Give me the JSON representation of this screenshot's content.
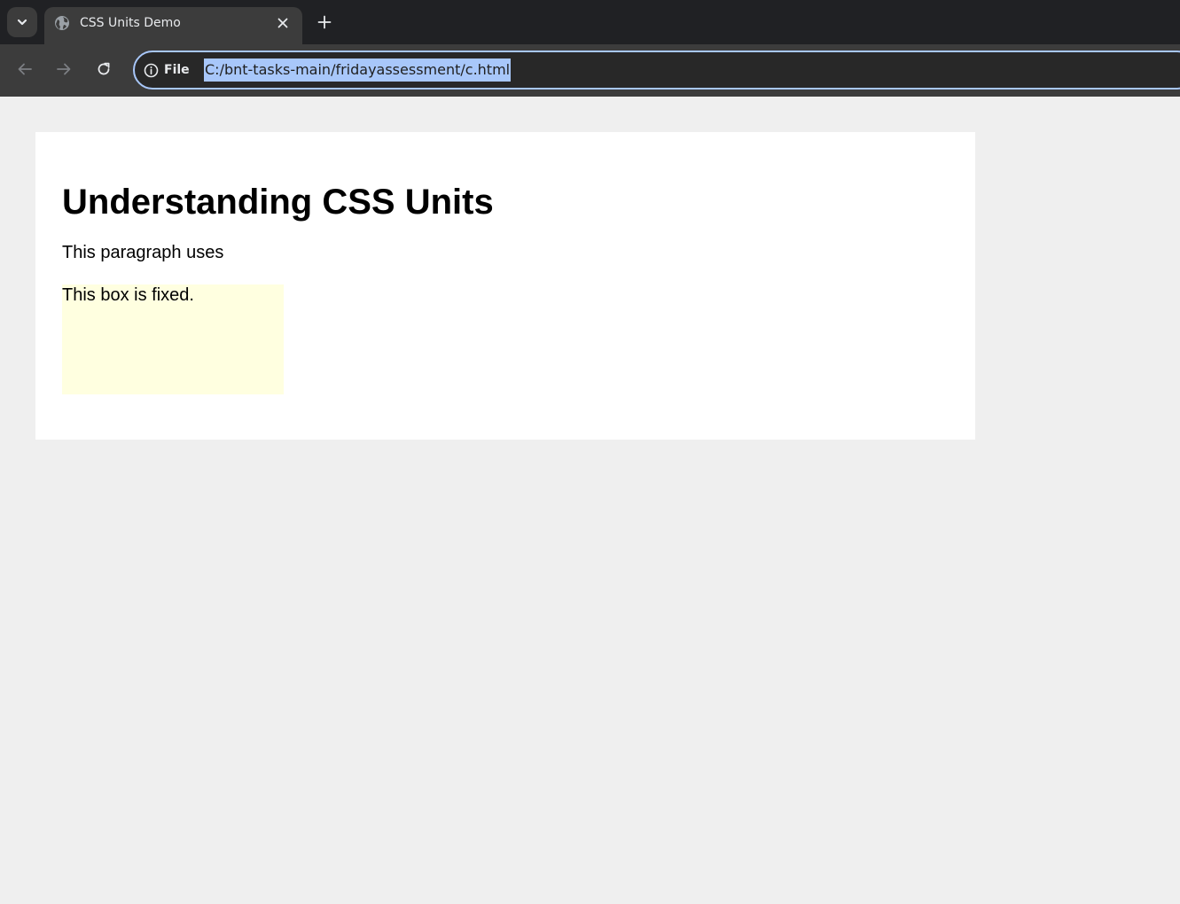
{
  "browser": {
    "tab": {
      "title": "CSS Units Demo",
      "favicon": "globe-icon"
    },
    "toolbar": {
      "back_icon": "arrow-left-icon",
      "forward_icon": "arrow-right-icon",
      "reload_icon": "reload-icon",
      "site_info_label": "File",
      "url": "C:/bnt-tasks-main/fridayassessment/c.html"
    },
    "colors": {
      "tabstrip": "#202124",
      "toolbar": "#3c3c3c",
      "omnibox_border": "#a8c7fa",
      "url_selection": "#a8c7fa"
    }
  },
  "page": {
    "heading": "Understanding CSS Units",
    "paragraph": "This paragraph uses",
    "box_text": "This box is fixed.",
    "colors": {
      "background": "#efefef",
      "card": "#ffffff",
      "box": "#ffffe0"
    }
  }
}
